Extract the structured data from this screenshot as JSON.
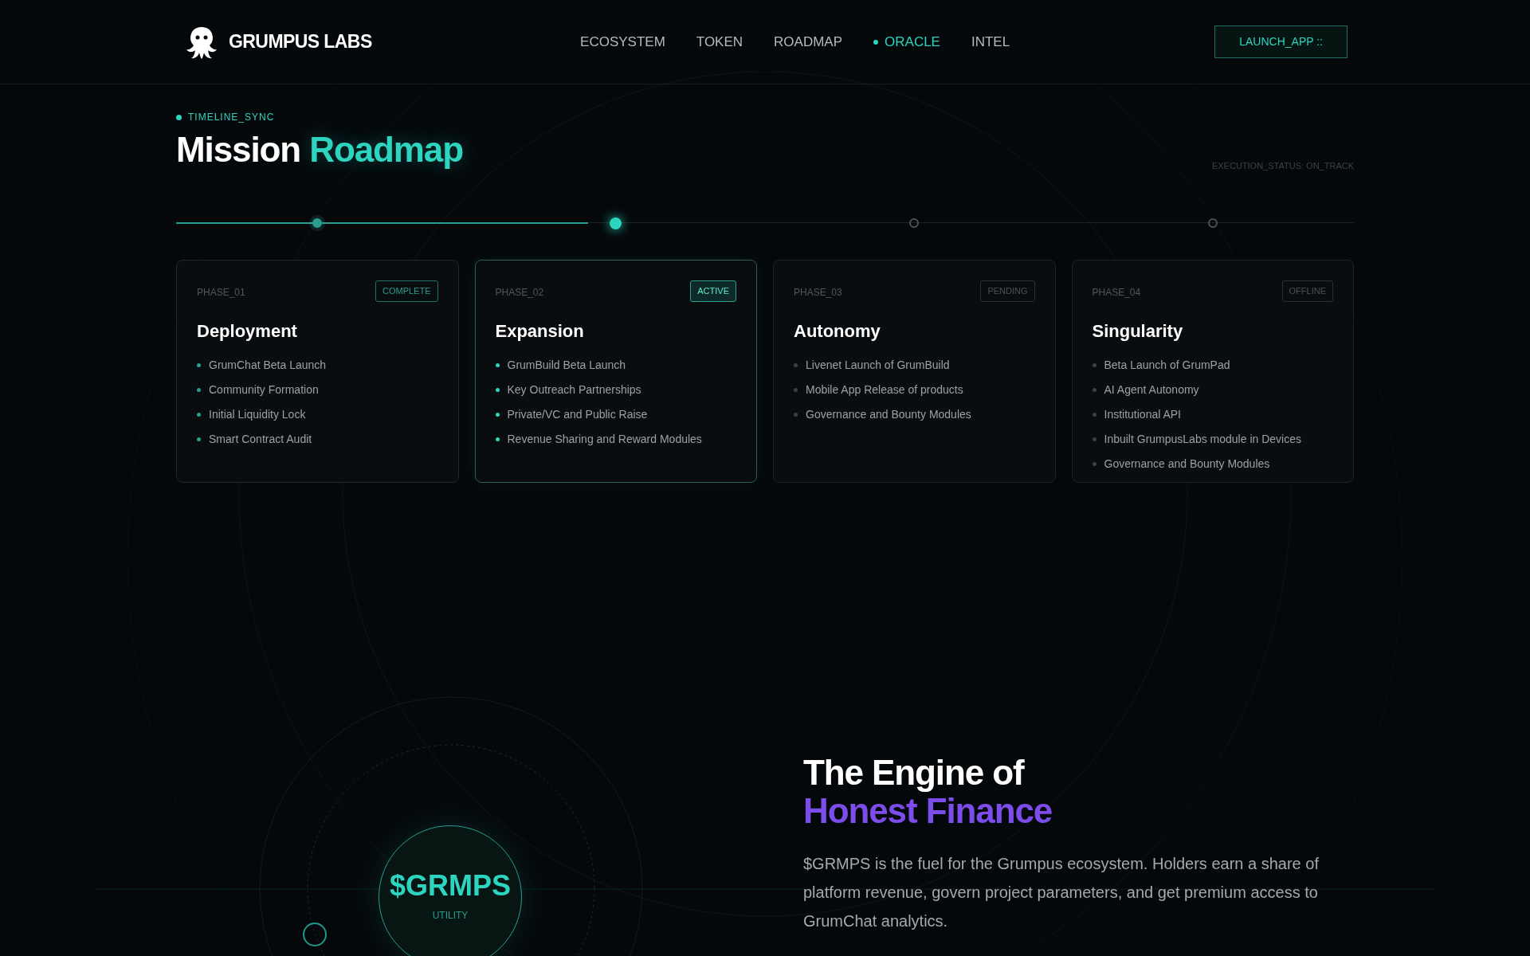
{
  "header": {
    "brand": "GRUMPUS LABS",
    "nav": [
      {
        "label": "ECOSYSTEM",
        "selected": false
      },
      {
        "label": "TOKEN",
        "selected": false
      },
      {
        "label": "ROADMAP",
        "selected": false
      },
      {
        "label": "ORACLE",
        "selected": true
      },
      {
        "label": "INTEL",
        "selected": false
      }
    ],
    "launch_button": "LAUNCH_APP ::"
  },
  "roadmap": {
    "eyebrow": "TIMELINE_SYNC",
    "title_lead": "Mission",
    "title_accent": "Roadmap",
    "status": "EXECUTION_STATUS: ON_TRACK",
    "timeline": {
      "level": 0.35
    },
    "phases": [
      {
        "label": "PHASE_01",
        "badge": "COMPLETE",
        "kind": "done",
        "title": "Deployment",
        "items": [
          "GrumChat Beta Launch",
          "Community Formation",
          "Initial Liquidity Lock",
          "Smart Contract Audit"
        ]
      },
      {
        "label": "PHASE_02",
        "badge": "ACTIVE",
        "kind": "current",
        "title": "Expansion",
        "items": [
          "GrumBuild Beta Launch",
          "Key Outreach Partnerships",
          "Private/VC and Public Raise",
          "Revenue Sharing and Reward Modules"
        ]
      },
      {
        "label": "PHASE_03",
        "badge": "PENDING",
        "kind": "queued",
        "title": "Autonomy",
        "items": [
          "Livenet Launch of GrumBuild",
          "Mobile App Release of products",
          "Governance and Bounty Modules"
        ]
      },
      {
        "label": "PHASE_04",
        "badge": "OFFLINE",
        "kind": "idle",
        "title": "Singularity",
        "items": [
          "Beta Launch of GrumPad",
          "AI Agent Autonomy",
          "Institutional API",
          "Inbuilt GrumpusLabs module in Devices",
          "Governance and Bounty Modules"
        ]
      }
    ]
  },
  "engine": {
    "token": {
      "symbol": "$GRMPS",
      "label": "UTILITY"
    },
    "headline_lead": "The Engine of",
    "headline_accent": "Honest Finance",
    "body": "$GRMPS is the fuel for the Grumpus ecosystem. Holders earn a share of platform revenue, govern project parameters, and get premium access to GrumChat analytics."
  }
}
